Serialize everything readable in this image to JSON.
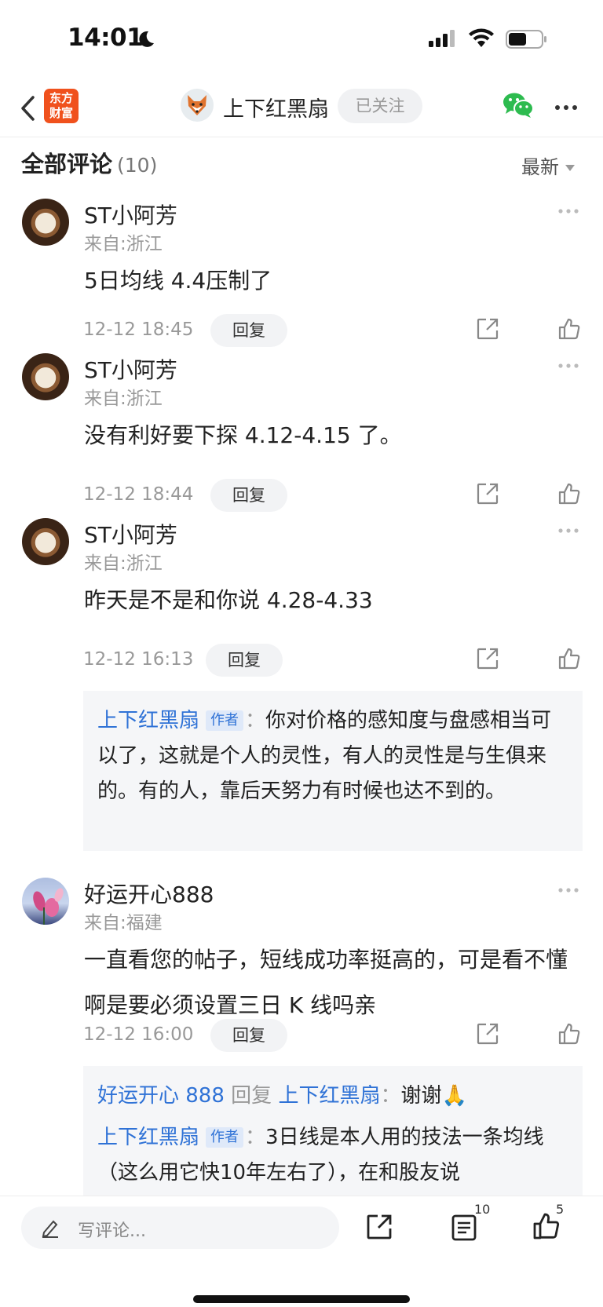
{
  "status_bar": {
    "time": "14:01"
  },
  "nav": {
    "logo_text": "东方财富",
    "author_name": "上下红黑扇",
    "follow_label": "已关注"
  },
  "header": {
    "title": "全部评论",
    "count": "(10)",
    "sort_label": "最新"
  },
  "comments": [
    {
      "user": "ST小阿芳",
      "location": "来自:浙江",
      "text": "5日均线 4.4压制了",
      "time": "12-12 18:45",
      "reply_label": "回复"
    },
    {
      "user": "ST小阿芳",
      "location": "来自:浙江",
      "text": "没有利好要下探 4.12-4.15 了。",
      "time": "12-12 18:44",
      "reply_label": "回复"
    },
    {
      "user": "ST小阿芳",
      "location": "来自:浙江",
      "text": "昨天是不是和你说 4.28-4.33",
      "time": "12-12 16:13",
      "reply_label": "回复",
      "reply": {
        "name": "上下红黑扇",
        "tag": "作者",
        "text": "你对价格的感知度与盘感相当可以了，这就是个人的灵性，有人的灵性是与生俱来的。有的人，靠后天努力有时候也达不到的。"
      }
    },
    {
      "user": "好运开心888",
      "location": "来自:福建",
      "text": "一直看您的帖子，短线成功率挺高的，可是看不懂啊是要必须设置三日 K 线吗亲",
      "time": "12-12 16:00",
      "reply_label": "回复",
      "replies": [
        {
          "name": "好运开心 888",
          "verb": "回复",
          "target": "上下红黑扇",
          "text": "谢谢🙏"
        },
        {
          "name": "上下红黑扇",
          "tag": "作者",
          "text": "3日线是本人用的技法一条均线（这么用它快10年左右了），在和股友说"
        }
      ]
    }
  ],
  "bottom_bar": {
    "input_placeholder": "写评论...",
    "comments_badge": "10",
    "likes_badge": "5"
  },
  "colors": {
    "brand": "#f0511d",
    "link_blue": "#2f72d6",
    "wechat_green": "#2dbb4f"
  },
  "icons": [
    "back-icon",
    "share-icon",
    "like-icon",
    "more-icon",
    "wechat-icon",
    "pencil-icon",
    "comments-icon"
  ]
}
